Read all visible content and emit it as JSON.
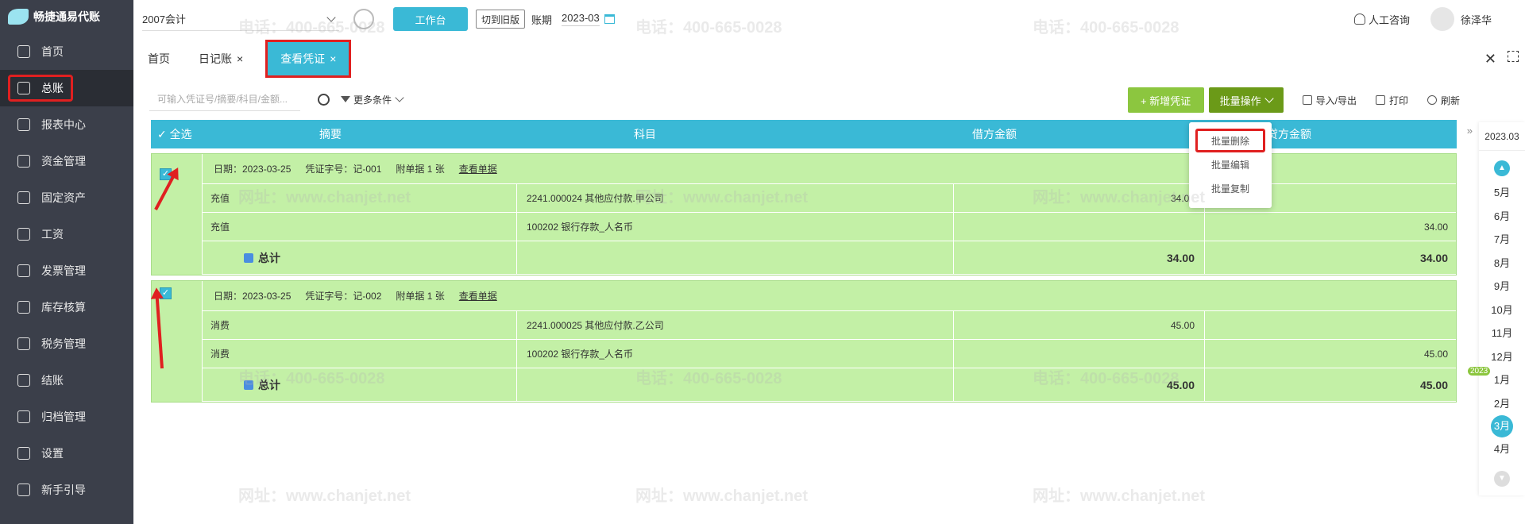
{
  "app": {
    "name": "畅捷通易代账"
  },
  "sidebar": {
    "items": [
      {
        "label": "首页"
      },
      {
        "label": "总账"
      },
      {
        "label": "报表中心"
      },
      {
        "label": "资金管理"
      },
      {
        "label": "固定资产"
      },
      {
        "label": "工资"
      },
      {
        "label": "发票管理"
      },
      {
        "label": "库存核算"
      },
      {
        "label": "税务管理"
      },
      {
        "label": "结账"
      },
      {
        "label": "归档管理"
      },
      {
        "label": "设置"
      },
      {
        "label": "新手引导"
      }
    ]
  },
  "topbar": {
    "account": "2007会计",
    "workbench": "工作台",
    "switch_label": "切到旧版",
    "period_label": "账期",
    "period_value": "2023-03",
    "consult": "人工咨询",
    "user": "徐泽华"
  },
  "tabs": [
    {
      "label": "首页"
    },
    {
      "label": "日记账"
    },
    {
      "label": "查看凭证"
    }
  ],
  "toolbar": {
    "search_placeholder": "可输入凭证号/摘要/科目/金额...",
    "more": "更多条件",
    "new_voucher": "+ 新增凭证",
    "batch": "批量操作",
    "import_export": "导入/导出",
    "print": "打印",
    "refresh": "刷新"
  },
  "grid": {
    "headers": {
      "select_all": "全选",
      "summary": "摘要",
      "subject": "科目",
      "debit": "借方金额",
      "credit": "贷方金额"
    }
  },
  "vouchers": [
    {
      "date": "日期：2023-03-25",
      "no": "凭证字号：记-001",
      "attach": "附单据 1 张",
      "view": "查看单据",
      "rows": [
        {
          "summary": "充值",
          "subject": "2241.000024 其他应付款.甲公司",
          "debit": "34.00",
          "credit": ""
        },
        {
          "summary": "充值",
          "subject": "100202 银行存款_人名币",
          "debit": "",
          "credit": "34.00"
        }
      ],
      "total_label": "总计",
      "total_debit": "34.00",
      "total_credit": "34.00"
    },
    {
      "date": "日期：2023-03-25",
      "no": "凭证字号：记-002",
      "attach": "附单据 1 张",
      "view": "查看单据",
      "rows": [
        {
          "summary": "消费",
          "subject": "2241.000025 其他应付款.乙公司",
          "debit": "45.00",
          "credit": ""
        },
        {
          "summary": "消费",
          "subject": "100202 银行存款_人名币",
          "debit": "",
          "credit": "45.00"
        }
      ],
      "total_label": "总计",
      "total_debit": "45.00",
      "total_credit": "45.00"
    }
  ],
  "dropdown": {
    "items": [
      "批量删除",
      "批量编辑",
      "批量复制"
    ]
  },
  "months": {
    "year_label": "2023.03",
    "year_badge": "2023",
    "list": [
      "5月",
      "6月",
      "7月",
      "8月",
      "9月",
      "10月",
      "11月",
      "12月",
      "1月",
      "2月",
      "3月",
      "4月"
    ],
    "current": "3月"
  },
  "watermark": {
    "phone": "电话：400-665-0028",
    "site": "网址：www.chanjet.net"
  },
  "colors": {
    "accent": "#3ab9d6",
    "voucher_bg": "#c3f0a6",
    "sidebar": "#3b3f4a",
    "new_btn": "#8cc63f",
    "batch_btn": "#6b9a18",
    "highlight": "#e02020"
  }
}
